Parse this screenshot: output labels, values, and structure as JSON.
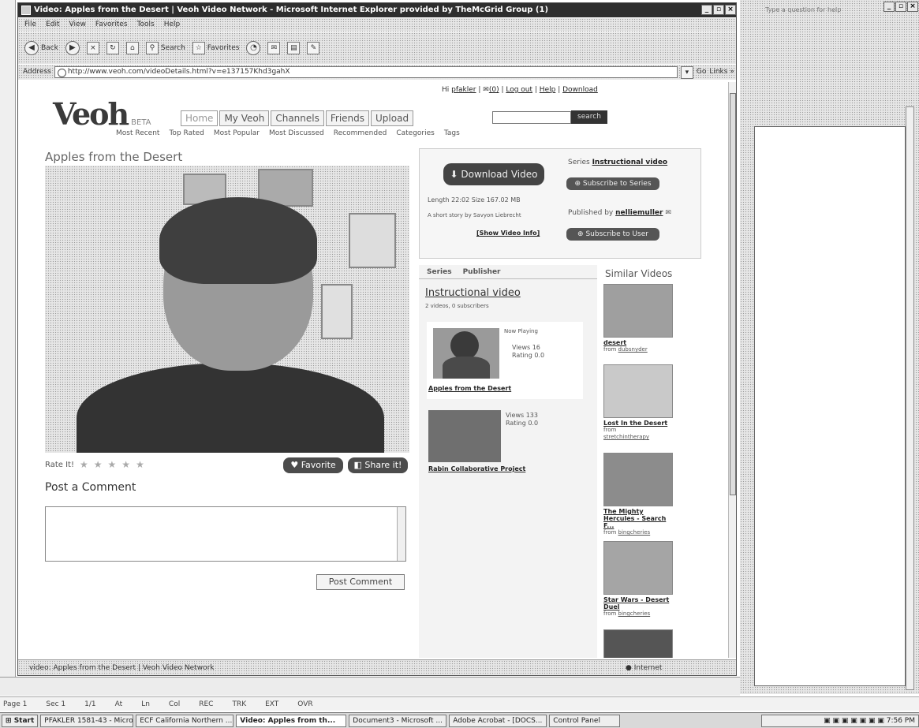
{
  "browser": {
    "title": "Video: Apples from the Desert | Veoh Video Network - Microsoft Internet Explorer provided by TheMcGrid Group (1)",
    "menu": [
      "File",
      "Edit",
      "View",
      "Favorites",
      "Tools",
      "Help"
    ],
    "toolbar": {
      "back": "Back",
      "search": "Search",
      "favorites": "Favorites"
    },
    "address_label": "Address",
    "address_url": "http://www.veoh.com/videoDetails.html?v=e137157Khd3gahX",
    "go": "Go",
    "links": "Links »",
    "status": "video: Apples from the Desert | Veoh Video Network",
    "zone": "Internet"
  },
  "site": {
    "logo": "Veoh",
    "beta": "BETA",
    "toplinks": {
      "hi": "Hi",
      "user": "pfakler",
      "inbox": "(0)",
      "logout": "Log out",
      "help": "Help",
      "download": "Download"
    },
    "tabs": [
      "Home",
      "My Veoh",
      "Channels",
      "Friends",
      "Upload"
    ],
    "search_btn": "search",
    "subnav": [
      "Most Recent",
      "Top Rated",
      "Most Popular",
      "Most Discussed",
      "Recommended",
      "Categories",
      "Tags"
    ]
  },
  "video": {
    "title": "Apples from the Desert",
    "rate_label": "Rate It!",
    "favorite": "Favorite",
    "share": "Share it!",
    "comment_title": "Post a Comment",
    "post_btn": "Post Comment"
  },
  "details": {
    "download": "Download Video",
    "meta": "Length 22:02  Size 167.02 MB",
    "desc": "A short story by Savyon Liebrecht",
    "show_info": "[Show Video Info]",
    "series_label": "Series",
    "series_name": "Instructional video",
    "subscribe_series": "Subscribe to Series",
    "published_by": "Published by",
    "publisher": "nelliemuller",
    "subscribe_user": "Subscribe to User"
  },
  "series": {
    "tabs": [
      "Series",
      "Publisher"
    ],
    "name": "Instructional video",
    "count": "2 videos, 0 subscribers",
    "items": [
      {
        "status": "Now Playing",
        "views": "Views 16",
        "rating": "Rating 0.0",
        "title": "Apples from the Desert"
      },
      {
        "views": "Views 133",
        "rating": "Rating 0.0",
        "title": "Rabin Collaborative Project"
      }
    ]
  },
  "similar": {
    "title": "Similar Videos",
    "items": [
      {
        "title": "desert",
        "from": "from",
        "user": "dubsnyder"
      },
      {
        "title": "Lost In the Desert",
        "from": "from",
        "user": "stretchintherapy"
      },
      {
        "title": "The Mighty Hercules - Search F...",
        "from": "from",
        "user": "bingcheries"
      },
      {
        "title": "Star Wars - Desert Duel",
        "from": "from",
        "user": "bingcheries"
      }
    ]
  },
  "word": {
    "help_box": "Type a question for help",
    "status": [
      "Page 1",
      "Sec 1",
      "1/1",
      "At",
      "Ln",
      "Col",
      "REC",
      "TRK",
      "EXT",
      "OVR"
    ]
  },
  "taskbar": {
    "start": "Start",
    "tasks": [
      "PFAKLER 1581-43 - Micro...",
      "ECF California Northern ...",
      "Video: Apples from th...",
      "Document3 - Microsoft ...",
      "Adobe Acrobat - [DOCS...",
      "Control Panel"
    ],
    "clock": "7:56 PM"
  }
}
